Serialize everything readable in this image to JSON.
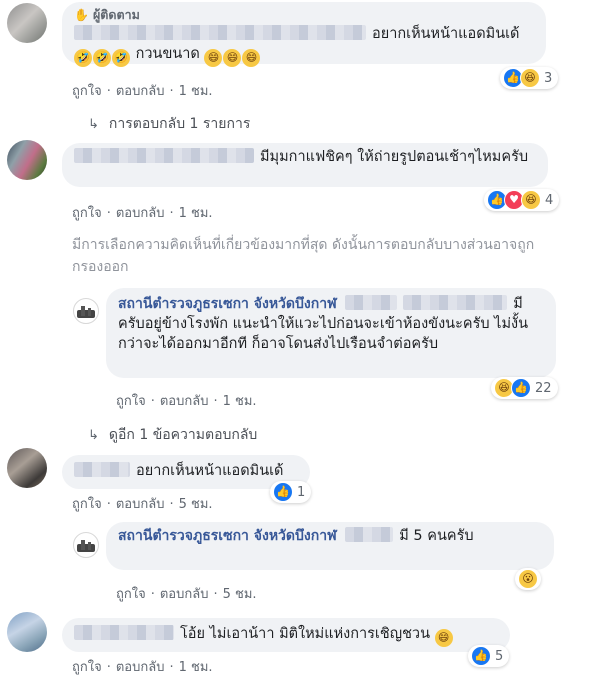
{
  "comments": [
    {
      "badge_icon": "wave-hand",
      "badge_label": "ผู้ติดตาม",
      "text": "อยากเห็นหน้าแอดมินเด้",
      "text2": "กวนขนาด",
      "like": "ถูกใจ",
      "reply": "ตอบกลับ",
      "time": "1 ชม.",
      "reactions": [
        "like",
        "haha"
      ],
      "reaction_count": "3",
      "replies_label": "การตอบกลับ 1 รายการ"
    },
    {
      "text": "มีมุมกาแฟชิคๆ ให้ถ่ายรูปตอนเช้าๆไหมครับ",
      "like": "ถูกใจ",
      "reply": "ตอบกลับ",
      "time": "1 ชม.",
      "reactions": [
        "like",
        "love",
        "haha"
      ],
      "reaction_count": "4"
    },
    {
      "text": "อยากเห็นหน้าแอดมินเด้",
      "like": "ถูกใจ",
      "reply": "ตอบกลับ",
      "time": "5 ชม.",
      "reactions": [
        "like"
      ],
      "reaction_count": "1"
    },
    {
      "text": "โอ้ย ไม่เอาน้าา มิติใหม่แห่งการเชิญชวน",
      "like": "ถูกใจ",
      "reply": "ตอบกลับ",
      "time": "1 ชม.",
      "reactions": [
        "like"
      ],
      "reaction_count": "5"
    }
  ],
  "filter_note": "มีการเลือกความคิดเห็นที่เกี่ยวข้องมากที่สุด ดังนั้นการตอบกลับบางส่วนอาจถูกกรองออก",
  "page_replies": [
    {
      "name": "สถานีตำรวจภูธรเซกา จังหวัดบึงกาฬ",
      "text": "มีครับอยู่ข้างโรงพัก แนะนำให้แวะไปก่อนจะเข้าห้องขังนะครับ ไม่งั้นกว่าจะได้ออกมาอีกที ก็อาจโดนส่งไปเรือนจำต่อครับ",
      "like": "ถูกใจ",
      "reply": "ตอบกลับ",
      "time": "1 ชม.",
      "reactions": [
        "haha",
        "like"
      ],
      "reaction_count": "22",
      "more_replies_label": "ดูอีก 1 ข้อความตอบกลับ"
    },
    {
      "name": "สถานีตำรวจภูธรเซกา จังหวัดบึงกาฬ",
      "text": "มี 5 คนครับ",
      "like": "ถูกใจ",
      "reply": "ตอบกลับ",
      "time": "5 ชม.",
      "reactions": [
        "wow"
      ],
      "reaction_count": ""
    }
  ]
}
